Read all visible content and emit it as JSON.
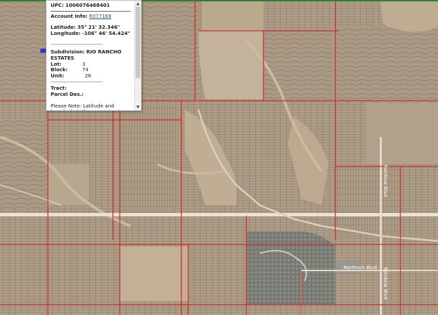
{
  "popup": {
    "upc_label": "UPC:",
    "upc_value": "1006076468401",
    "account_label": "Account Info:",
    "account_value": "R077169",
    "lat_label": "Latitude:",
    "lat_value": "35° 21' 32.346\"",
    "lon_label": "Longitude:",
    "lon_value": "-106° 46' 54.424\"",
    "dash_line": "------------------------------------",
    "subdivision_label": "Subdivision:",
    "subdivision_value": "RIO RANCHO ESTATES",
    "lot_label": "Lot:",
    "lot_value": "3",
    "block_label": "Block:",
    "block_value": "74",
    "unit_label": "Unit:",
    "unit_value": "26",
    "tract_label": "Tract:",
    "parcel_label": "Parcel Des.:",
    "note": "Please Note: Latitude and Longitude is the approximate center of the parcel shown."
  },
  "scroll": {
    "up": "▲",
    "down": "▼"
  },
  "map": {
    "imagery_color": "#b6a58f",
    "boundary_color": "#d42a2a",
    "road_color": "#e9e3d6",
    "road_labels": [
      "Rainbow Blvd",
      "Northern Blvd",
      "Rainbow Blvd"
    ]
  }
}
